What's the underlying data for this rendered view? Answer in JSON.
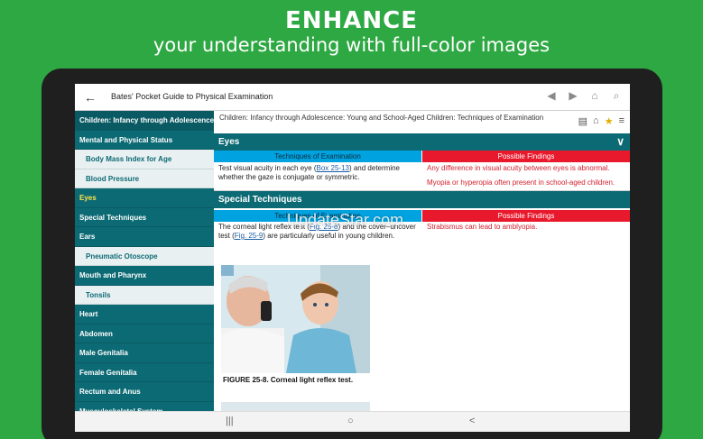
{
  "promo": {
    "headline": "ENHANCE",
    "subline": "your understanding with full-color images"
  },
  "appbar": {
    "back_icon": "←",
    "title": "Bates' Pocket Guide to Physical Examination",
    "icons": {
      "prev": "◀",
      "next": "▶",
      "home": "⌂",
      "search": "⌕"
    }
  },
  "sidebar": {
    "items": [
      {
        "label": "Children: Infancy through Adolescence...",
        "type": "top"
      },
      {
        "label": "Mental and Physical Status",
        "type": "main"
      },
      {
        "label": "Body Mass Index for Age",
        "type": "sub"
      },
      {
        "label": "Blood Pressure",
        "type": "sub"
      },
      {
        "label": "Eyes",
        "type": "active"
      },
      {
        "label": "Special Techniques",
        "type": "main"
      },
      {
        "label": "Ears",
        "type": "main"
      },
      {
        "label": "Pneumatic Otoscope",
        "type": "sub"
      },
      {
        "label": "Mouth and Pharynx",
        "type": "main"
      },
      {
        "label": "Tonsils",
        "type": "sub"
      },
      {
        "label": "Heart",
        "type": "main"
      },
      {
        "label": "Abdomen",
        "type": "main"
      },
      {
        "label": "Male Genitalia",
        "type": "main"
      },
      {
        "label": "Female Genitalia",
        "type": "main"
      },
      {
        "label": "Rectum and Anus",
        "type": "main"
      },
      {
        "label": "Musculoskeletal System",
        "type": "main"
      }
    ]
  },
  "content": {
    "breadcrumb": "Children: Infancy through Adolescence: Young and School-Aged Children: Techniques of Examination",
    "tools": {
      "notes": "▤",
      "tag": "⌂",
      "star": "★",
      "list": "≡"
    },
    "eyes": {
      "title": "Eyes",
      "chevron": "∨",
      "col_left": "Techniques of Examination",
      "col_right": "Possible Findings",
      "tech_1": "Test visual acuity in each eye (",
      "tech_1_link": "Box 25-13",
      "tech_2": ") and determine whether the gaze is conjugate or symmetric.",
      "finding_1": "Any difference in visual acuity between eyes is abnormal.",
      "finding_2": "Myopia or hyperopia often present in school-aged children."
    },
    "special": {
      "title": "Special Techniques",
      "col_left": "Techniques of Examination",
      "col_right": "Possible Findings",
      "tech_1": "The corneal light reflex test (",
      "tech_1_link": "Fig. 25-8",
      "tech_2": ") and the cover–uncover test (",
      "tech_2_link": "Fig. 25-9",
      "tech_3": ") are particularly useful in young children.",
      "finding_1": "Strabismus can lead to amblyopia."
    },
    "figure_caption": "FIGURE 25-8. Corneal light reflex test."
  },
  "watermark": "UpdateStar.com",
  "navbar": {
    "recent": "|||",
    "home": "○",
    "back": "<"
  },
  "colors": {
    "teal": "#0c6a74",
    "blue_header": "#00a3e0",
    "red_header": "#e8192c",
    "background": "#2ea843"
  }
}
